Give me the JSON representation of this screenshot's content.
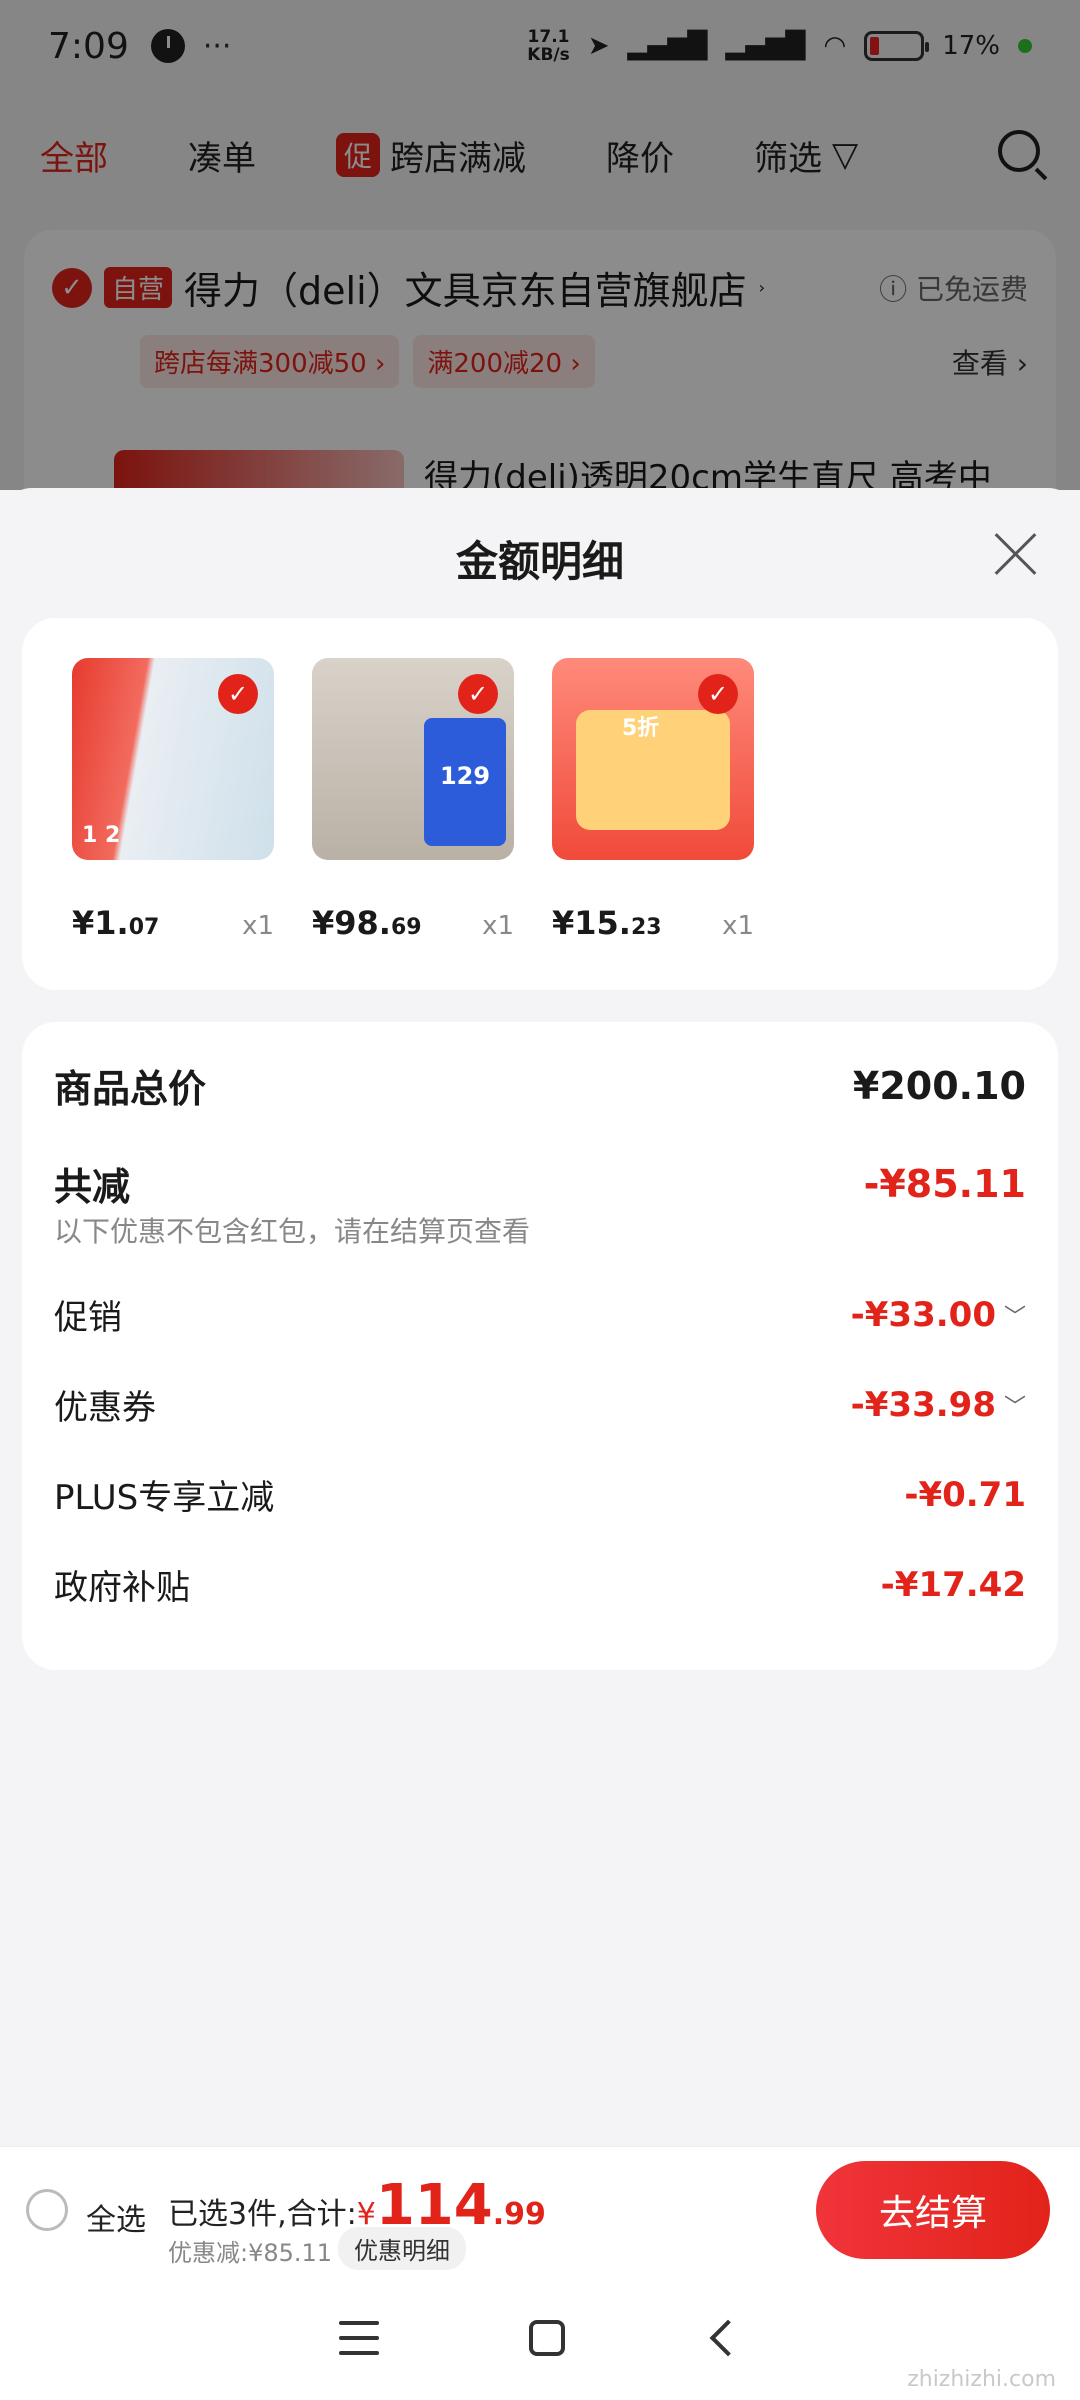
{
  "status_bar": {
    "time": "7:09",
    "dots": "···",
    "net_speed_value": "17.1",
    "net_speed_unit": "KB/s",
    "battery": "17%",
    "battery_level": 0.17
  },
  "filter_tabs": [
    {
      "label": "全部"
    },
    {
      "label": "凑单"
    },
    {
      "label": "跨店满减",
      "badge": "促"
    },
    {
      "label": "降价"
    },
    {
      "label": "筛选"
    }
  ],
  "store": {
    "self_badge": "自营",
    "name": "得力（deli）文具京东自营旗舰店",
    "shipping": "已免运费",
    "coupons": [
      "跨店每满300减50 ›",
      "满200减20 ›"
    ],
    "view": "查看 ›",
    "item_title": "得力(deli)透明20cm学生直尺 高考中"
  },
  "sheet": {
    "title": "金额明细"
  },
  "products": [
    {
      "price_int": "¥1.",
      "price_dec": "07",
      "qty": "x1",
      "thumb_text": "1 2"
    },
    {
      "price_int": "¥98.",
      "price_dec": "69",
      "qty": "x1",
      "thumb_text": "129"
    },
    {
      "price_int": "¥15.",
      "price_dec": "23",
      "qty": "x1",
      "thumb_text": "5折"
    }
  ],
  "summary": {
    "total_label": "商品总价",
    "total_value": "¥200.10",
    "reduce_label": "共减",
    "reduce_value": "-¥85.11",
    "note": "以下优惠不包含红包，请在结算页查看",
    "rows": [
      {
        "label": "促销",
        "value": "-¥33.00"
      },
      {
        "label": "优惠券",
        "value": "-¥33.98"
      },
      {
        "label": "PLUS专享立减",
        "value": "-¥0.71"
      },
      {
        "label": "政府补贴",
        "value": "-¥17.42"
      }
    ]
  },
  "bottom": {
    "select_all": "全选",
    "selected_text": "已选3件,合计:",
    "currency": "¥",
    "total_int": "114",
    "total_dec": ".99",
    "discount": "优惠减:¥85.11",
    "detail_chip": "优惠明细",
    "checkout": "去结算"
  },
  "watermark": "zhizhizhi.com",
  "colors": {
    "accent": "#e2231a",
    "background": "#f4f4f6"
  }
}
